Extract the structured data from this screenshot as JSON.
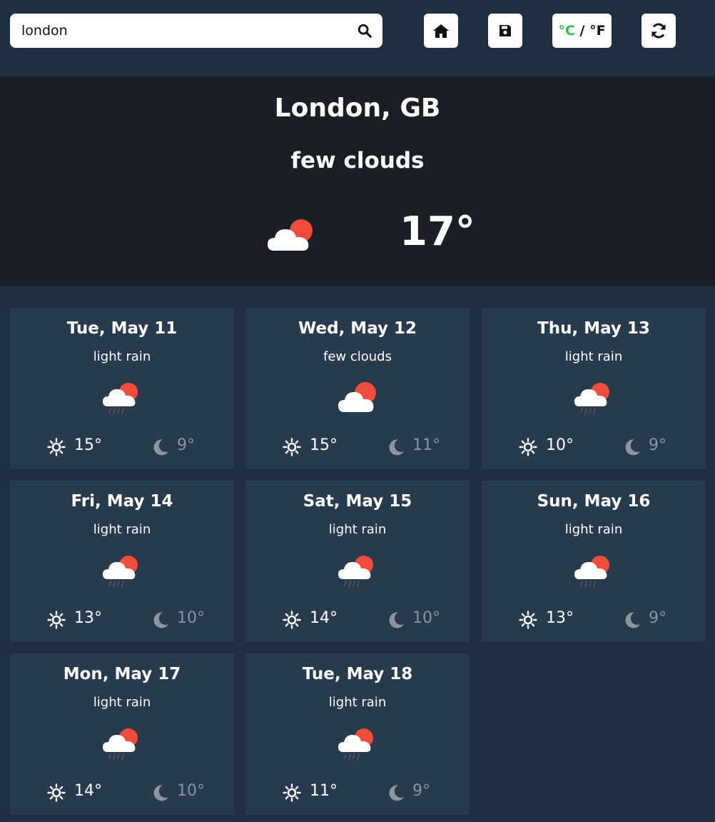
{
  "search": {
    "value": "london",
    "icon": "search-icon"
  },
  "toolbar": {
    "home_icon": "home-icon",
    "save_icon": "save-icon",
    "unit_celsius": "°C",
    "unit_sep": " / ",
    "unit_fahrenheit": "°F",
    "refresh_icon": "refresh-icon"
  },
  "current": {
    "city": "London, GB",
    "description": "few clouds",
    "temperature": "17°",
    "icon": "few-clouds-icon"
  },
  "colors": {
    "page_bg": "#1f2f40",
    "hero_bg": "#1a1e25",
    "card_bg": "#283a4e",
    "sun_red": "#f24c3d",
    "celsius_green": "#2fbf4a",
    "night_gray": "#8b959e"
  },
  "forecast": [
    {
      "day": "Tue, May 11",
      "description": "light rain",
      "icon": "light-rain-icon",
      "high": "15°",
      "low": "9°"
    },
    {
      "day": "Wed, May 12",
      "description": "few clouds",
      "icon": "few-clouds-icon",
      "high": "15°",
      "low": "11°"
    },
    {
      "day": "Thu, May 13",
      "description": "light rain",
      "icon": "light-rain-icon",
      "high": "10°",
      "low": "9°"
    },
    {
      "day": "Fri, May 14",
      "description": "light rain",
      "icon": "light-rain-icon",
      "high": "13°",
      "low": "10°"
    },
    {
      "day": "Sat, May 15",
      "description": "light rain",
      "icon": "light-rain-icon",
      "high": "14°",
      "low": "10°"
    },
    {
      "day": "Sun, May 16",
      "description": "light rain",
      "icon": "light-rain-icon",
      "high": "13°",
      "low": "9°"
    },
    {
      "day": "Mon, May 17",
      "description": "light rain",
      "icon": "light-rain-icon",
      "high": "14°",
      "low": "10°"
    },
    {
      "day": "Tue, May 18",
      "description": "light rain",
      "icon": "light-rain-icon",
      "high": "11°",
      "low": "9°"
    }
  ]
}
